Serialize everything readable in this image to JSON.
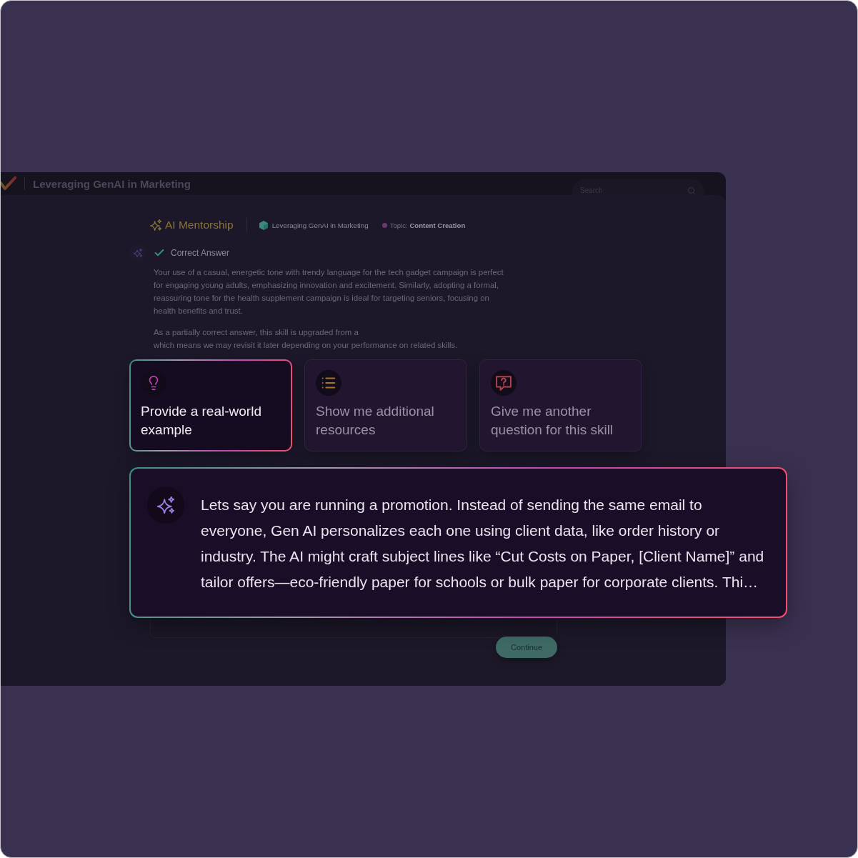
{
  "app_bar": {
    "title": "Leveraging GenAI in Marketing",
    "search": {
      "placeholder": "Search"
    }
  },
  "mentorship": {
    "title": "AI Mentorship",
    "course": "Leveraging GenAI in Marketing",
    "topic": "Topic: **Content Creation**"
  },
  "feedback": {
    "status": "Correct Answer",
    "correct": true,
    "paragraph": "Your use of a casual, energetic tone with trendy language for the tech gadget campaign is perfect for engaging young adults, emphasizing innovation and excitement. Similarly, adopting a formal, reassuring tone for the health supplement campaign is ideal for targeting seniors, focusing on health benefits and trust.",
    "note_lines": [
      "As a partially correct answer, this skill is upgraded from a",
      "which means we may revisit it later depending on your performance on related skills."
    ]
  },
  "suggestions": [
    {
      "kind": "example",
      "label": "Provide a real-world example",
      "selected": true
    },
    {
      "kind": "resources",
      "label": "Show me additional resources",
      "selected": false
    },
    {
      "kind": "question",
      "label": "Give me another question for this skill",
      "selected": false
    }
  ],
  "response": {
    "text": "Lets say you are running a promotion. Instead of sending the same email to everyone, Gen AI personalizes each one using client data, like order history or industry. The AI might craft subject lines like “Cut Costs on Paper, [Client Name]” and tailor offers—eco-friendly paper for schools or bulk paper for corporate clients. Thi…"
  },
  "continue_button": {
    "label": "Continue"
  }
}
